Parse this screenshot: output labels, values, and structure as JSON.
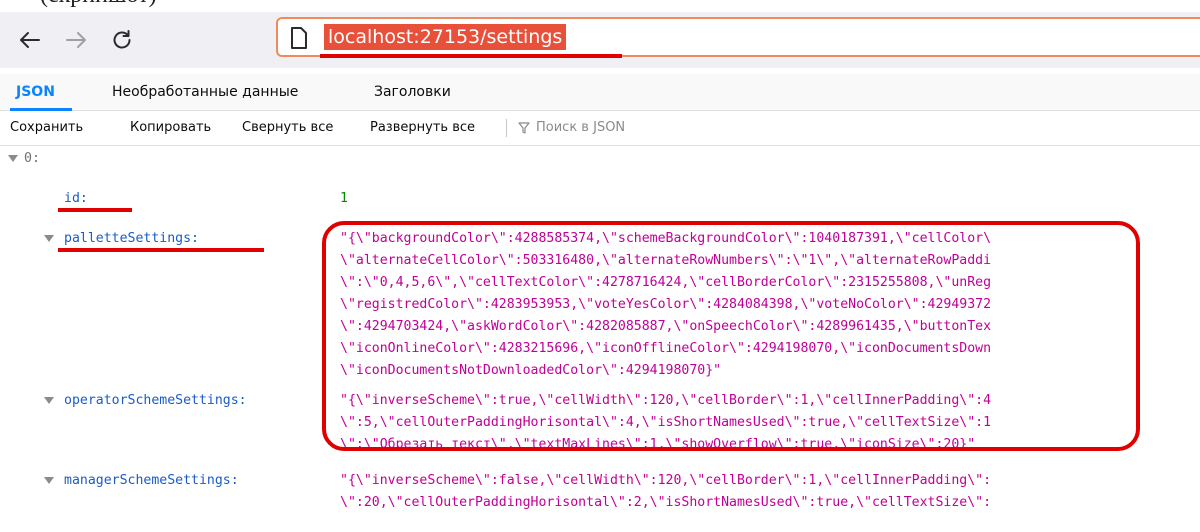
{
  "url": "localhost:27153/settings",
  "tabs": [
    "JSON",
    "Необработанные данные",
    "Заголовки"
  ],
  "toolbar": {
    "save": "Сохранить",
    "copy": "Копировать",
    "collapse_all": "Свернуть все",
    "expand_all": "Развернуть все",
    "filter_placeholder": "Поиск в JSON"
  },
  "tree": {
    "root_key": "0:",
    "id_key": "id:",
    "id_value": "1",
    "palette_key": "palletteSettings:",
    "palette_lines": [
      "\"{\\\"backgroundColor\\\":4288585374,\\\"schemeBackgroundColor\\\":1040187391,\\\"cellColor\\",
      "\\\"alternateCellColor\\\":503316480,\\\"alternateRowNumbers\\\":\\\"1\\\",\\\"alternateRowPaddi",
      "\\\":\\\"0,4,5,6\\\",\\\"cellTextColor\\\":4278716424,\\\"cellBorderColor\\\":2315255808,\\\"unReg",
      "\\\"registredColor\\\":4283953953,\\\"voteYesColor\\\":4284084398,\\\"voteNoColor\\\":42949372",
      "\\\":4294703424,\\\"askWordColor\\\":4282085887,\\\"onSpeechColor\\\":4289961435,\\\"buttonTex",
      "\\\"iconOnlineColor\\\":4283215696,\\\"iconOfflineColor\\\":4294198070,\\\"iconDocumentsDown",
      "\\\"iconDocumentsNotDownloadedColor\\\":4294198070}\""
    ],
    "operator_key": "operatorSchemeSettings:",
    "operator_lines": [
      "\"{\\\"inverseScheme\\\":true,\\\"cellWidth\\\":120,\\\"cellBorder\\\":1,\\\"cellInnerPadding\\\":4",
      "\\\":5,\\\"cellOuterPaddingHorisontal\\\":4,\\\"isShortNamesUsed\\\":true,\\\"cellTextSize\\\":1",
      "\\\":\\\"Обрезать текст\\\",\\\"textMaxLines\\\":1,\\\"showOverflow\\\":true,\\\"iconSize\\\":20}\""
    ],
    "manager_key": "managerSchemeSettings:",
    "manager_lines": [
      "\"{\\\"inverseScheme\\\":false,\\\"cellWidth\\\":120,\\\"cellBorder\\\":1,\\\"cellInnerPadding\\\":",
      "\\\":20,\\\"cellOuterPaddingHorisontal\\\":2,\\\"isShortNamesUsed\\\":true,\\\"cellTextSize\\\":"
    ]
  },
  "colors": {
    "key": "#1a5cc7",
    "number": "#058b00",
    "string": "#c00096",
    "annotation": "#e00000",
    "accent": "#0a84ff",
    "url_highlight": "#e8503a"
  },
  "icons": {
    "back": "arrow-left-icon",
    "forward": "arrow-right-icon",
    "reload": "reload-icon",
    "page": "page-icon",
    "filter": "filter-icon",
    "expander": "triangle-down-icon"
  }
}
